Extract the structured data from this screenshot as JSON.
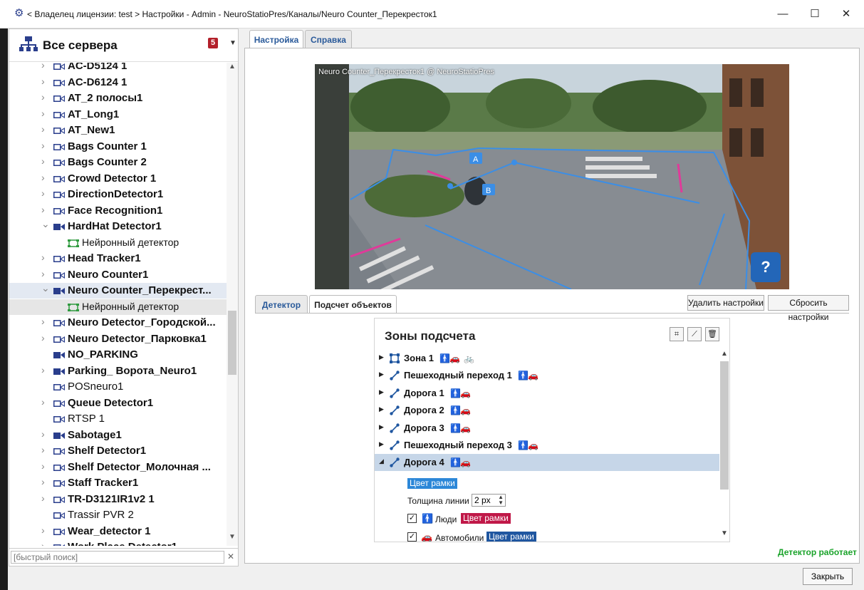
{
  "window": {
    "title": "< Владелец лицензии: test > Настройки - Admin - NeuroStatioPres/Каналы/Neuro Counter_Перекресток1",
    "minimize_icon": "minimize-icon",
    "maximize_icon": "maximize-icon",
    "close_icon": "close-icon"
  },
  "servers": {
    "title": "Все сервера",
    "badge": "5"
  },
  "tree": [
    {
      "label": "AC-D5124 1",
      "bold": true,
      "expand": "collapsed",
      "icon": "camera-outline"
    },
    {
      "label": "AC-D6124 1",
      "bold": true,
      "expand": "collapsed",
      "icon": "camera-outline"
    },
    {
      "label": "AT_2 полосы1",
      "bold": true,
      "expand": "collapsed",
      "icon": "camera-outline"
    },
    {
      "label": "AT_Long1",
      "bold": true,
      "expand": "collapsed",
      "icon": "camera-outline"
    },
    {
      "label": "AT_New1",
      "bold": true,
      "expand": "collapsed",
      "icon": "camera-outline"
    },
    {
      "label": "Bags Counter 1",
      "bold": true,
      "expand": "collapsed",
      "icon": "camera-outline"
    },
    {
      "label": "Bags Counter 2",
      "bold": true,
      "expand": "collapsed",
      "icon": "camera-outline"
    },
    {
      "label": "Crowd Detector 1",
      "bold": true,
      "expand": "collapsed",
      "icon": "camera-outline"
    },
    {
      "label": "DirectionDetector1",
      "bold": true,
      "expand": "collapsed",
      "icon": "camera-outline"
    },
    {
      "label": "Face Recognition1",
      "bold": true,
      "expand": "collapsed",
      "icon": "camera-outline"
    },
    {
      "label": "HardHat Detector1",
      "bold": true,
      "expand": "expanded",
      "icon": "camera-filled"
    },
    {
      "label": "Нейронный детектор",
      "bold": false,
      "expand": "none",
      "icon": "detector",
      "child": true
    },
    {
      "label": "Head Tracker1",
      "bold": true,
      "expand": "collapsed",
      "icon": "camera-outline"
    },
    {
      "label": "Neuro Counter1",
      "bold": true,
      "expand": "collapsed",
      "icon": "camera-outline"
    },
    {
      "label": "Neuro Counter_Перекрест...",
      "bold": true,
      "expand": "expanded",
      "icon": "camera-filled",
      "selected": true
    },
    {
      "label": "Нейронный детектор",
      "bold": false,
      "expand": "none",
      "icon": "detector",
      "child": true,
      "subselected": true
    },
    {
      "label": "Neuro Detector_Городской...",
      "bold": true,
      "expand": "collapsed",
      "icon": "camera-outline"
    },
    {
      "label": "Neuro Detector_Парковка1",
      "bold": true,
      "expand": "collapsed",
      "icon": "camera-outline"
    },
    {
      "label": "NO_PARKING",
      "bold": true,
      "expand": "none",
      "icon": "camera-filled"
    },
    {
      "label": "Parking_ Ворота_Neuro1",
      "bold": true,
      "expand": "collapsed",
      "icon": "camera-filled"
    },
    {
      "label": "POSneuro1",
      "bold": false,
      "expand": "none",
      "icon": "camera-outline"
    },
    {
      "label": "Queue Detector1",
      "bold": true,
      "expand": "collapsed",
      "icon": "camera-outline"
    },
    {
      "label": "RTSP 1",
      "bold": false,
      "expand": "none",
      "icon": "camera-outline"
    },
    {
      "label": "Sabotage1",
      "bold": true,
      "expand": "collapsed",
      "icon": "camera-filled"
    },
    {
      "label": "Shelf Detector1",
      "bold": true,
      "expand": "collapsed",
      "icon": "camera-outline"
    },
    {
      "label": "Shelf Detector_Молочная ...",
      "bold": true,
      "expand": "collapsed",
      "icon": "camera-outline"
    },
    {
      "label": "Staff Tracker1",
      "bold": true,
      "expand": "collapsed",
      "icon": "camera-outline"
    },
    {
      "label": "TR-D3121IR1v2 1",
      "bold": true,
      "expand": "collapsed",
      "icon": "camera-outline"
    },
    {
      "label": "Trassir PVR 2",
      "bold": false,
      "expand": "none",
      "icon": "camera-outline"
    },
    {
      "label": "Wear_detector 1",
      "bold": true,
      "expand": "collapsed",
      "icon": "camera-outline"
    },
    {
      "label": "Work Place Detector1",
      "bold": true,
      "expand": "collapsed",
      "icon": "camera-outline"
    }
  ],
  "quick_search": {
    "placeholder": "[быстрый поиск]",
    "clear_icon": "clear-icon"
  },
  "tabs": [
    "Настройка",
    "Справка"
  ],
  "video": {
    "caption": "Neuro Counter_Перекресток1 @ NeuroStatioPres",
    "help_label": "?",
    "marker_a": "A",
    "marker_b": "B"
  },
  "subtabs": [
    "Детектор",
    "Подсчет объектов"
  ],
  "buttons": {
    "delete": "Удалить настройки",
    "reset": "Сбросить настройки",
    "close": "Закрыть"
  },
  "zones": {
    "title": "Зоны подсчета",
    "tool_icons": [
      "add-zone-icon",
      "add-line-icon",
      "delete-icon"
    ],
    "items": [
      {
        "name": "Зона 1",
        "icon": "zone-icon",
        "types": [
          "person",
          "car",
          "bike"
        ]
      },
      {
        "name": "Пешеходный переход 1",
        "icon": "line-icon",
        "types": [
          "person",
          "car"
        ]
      },
      {
        "name": "Дорога 1",
        "icon": "line-icon",
        "types": [
          "person",
          "car"
        ]
      },
      {
        "name": "Дорога 2",
        "icon": "line-icon",
        "types": [
          "person",
          "car"
        ]
      },
      {
        "name": "Дорога 3",
        "icon": "line-icon",
        "types": [
          "person",
          "car"
        ]
      },
      {
        "name": "Пешеходный переход 3",
        "icon": "line-icon",
        "types": [
          "person",
          "car"
        ]
      },
      {
        "name": "Дорога 4",
        "icon": "line-icon",
        "types": [
          "person",
          "car"
        ],
        "selected": true
      }
    ],
    "frame_color_label": "Цвет рамки",
    "line_width_label": "Толщина линии",
    "line_width_value": "2 px",
    "people_label": "Люди",
    "people_color_label": "Цвет рамки",
    "cars_label": "Автомобили",
    "cars_color_label": "Цвет рамки",
    "colors": {
      "frame": "#2c87d8",
      "people": "#c01848",
      "cars": "#1f56a0"
    }
  },
  "status": "Детектор работает",
  "colors": {
    "accent": "#2a5a9a",
    "status_ok": "#1aa32a",
    "badge": "#b3202a"
  }
}
